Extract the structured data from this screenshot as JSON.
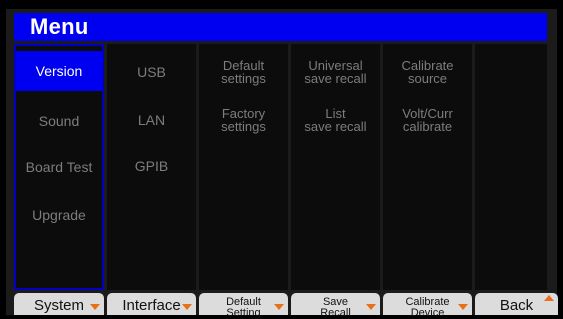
{
  "header": {
    "title": "Menu"
  },
  "columns": [
    {
      "items": [
        "Version",
        "Sound",
        "Board Test",
        "Upgrade"
      ],
      "active_index": 0
    },
    {
      "items": [
        "USB",
        "LAN",
        "GPIB"
      ]
    },
    {
      "items": [
        [
          "Default",
          "settings"
        ],
        [
          "Factory",
          "settings"
        ]
      ]
    },
    {
      "items": [
        [
          "Universal",
          "save recall"
        ],
        [
          "List",
          "save recall"
        ]
      ]
    },
    {
      "items": [
        [
          "Calibrate",
          "source"
        ],
        [
          "Volt/Curr",
          "calibrate"
        ]
      ]
    }
  ],
  "softkeys": [
    {
      "label": "System",
      "icon": "arrow-down-icon"
    },
    {
      "label": "Interface",
      "icon": "arrow-down-icon"
    },
    {
      "label_line1": "Default",
      "label_line2": "Setting",
      "icon": "arrow-down-icon"
    },
    {
      "label_line1": "Save",
      "label_line2": "Recall",
      "icon": "arrow-down-icon"
    },
    {
      "label_line1": "Calibrate",
      "label_line2": "Device",
      "icon": "arrow-down-icon"
    },
    {
      "label": "Back",
      "icon": "arrow-up-icon"
    }
  ],
  "colors": {
    "header_blue": "#0000f0",
    "selection_border": "#0000c8",
    "arrow_orange": "#e8701a",
    "softkey_bg": "#dcdcdc"
  }
}
